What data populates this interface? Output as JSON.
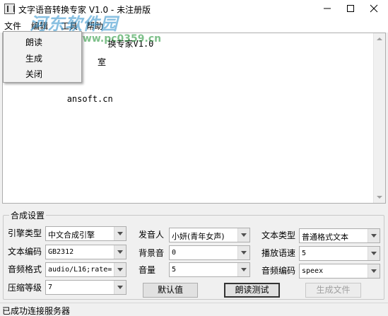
{
  "window": {
    "title": "文字语音转换专家 V1.0 - 未注册版"
  },
  "watermark": {
    "text": "河东软件园",
    "url": "www.pc0359.cn"
  },
  "menubar": {
    "items": [
      "文件",
      "编辑",
      "工具",
      "帮助"
    ]
  },
  "file_menu": {
    "items": [
      "朗读",
      "生成",
      "关闭"
    ]
  },
  "editor": {
    "text": "                    换专家V1.0\n                  室\n\n            ansoft.cn"
  },
  "settings": {
    "title": "合成设置",
    "engine_label": "引擎类型",
    "engine_value": "中文合成引擎",
    "encoding_label": "文本编码",
    "encoding_value": "GB2312",
    "audio_format_label": "音频格式",
    "audio_format_value": "audio/L16;rate=",
    "compression_label": "压缩等级",
    "compression_value": "7",
    "voice_label": "发音人",
    "voice_value": "小妍(青年女声)",
    "bg_sound_label": "背景音",
    "bg_sound_value": "0",
    "volume_label": "音量",
    "volume_value": "5",
    "text_type_label": "文本类型",
    "text_type_value": "普通格式文本",
    "speed_label": "播放语速",
    "speed_value": "5",
    "audio_codec_label": "音频编码",
    "audio_codec_value": "speex",
    "default_button": "默认值",
    "test_button": "朗读测试",
    "generate_button": "生成文件"
  },
  "status": {
    "text": "已成功连接服务器"
  }
}
